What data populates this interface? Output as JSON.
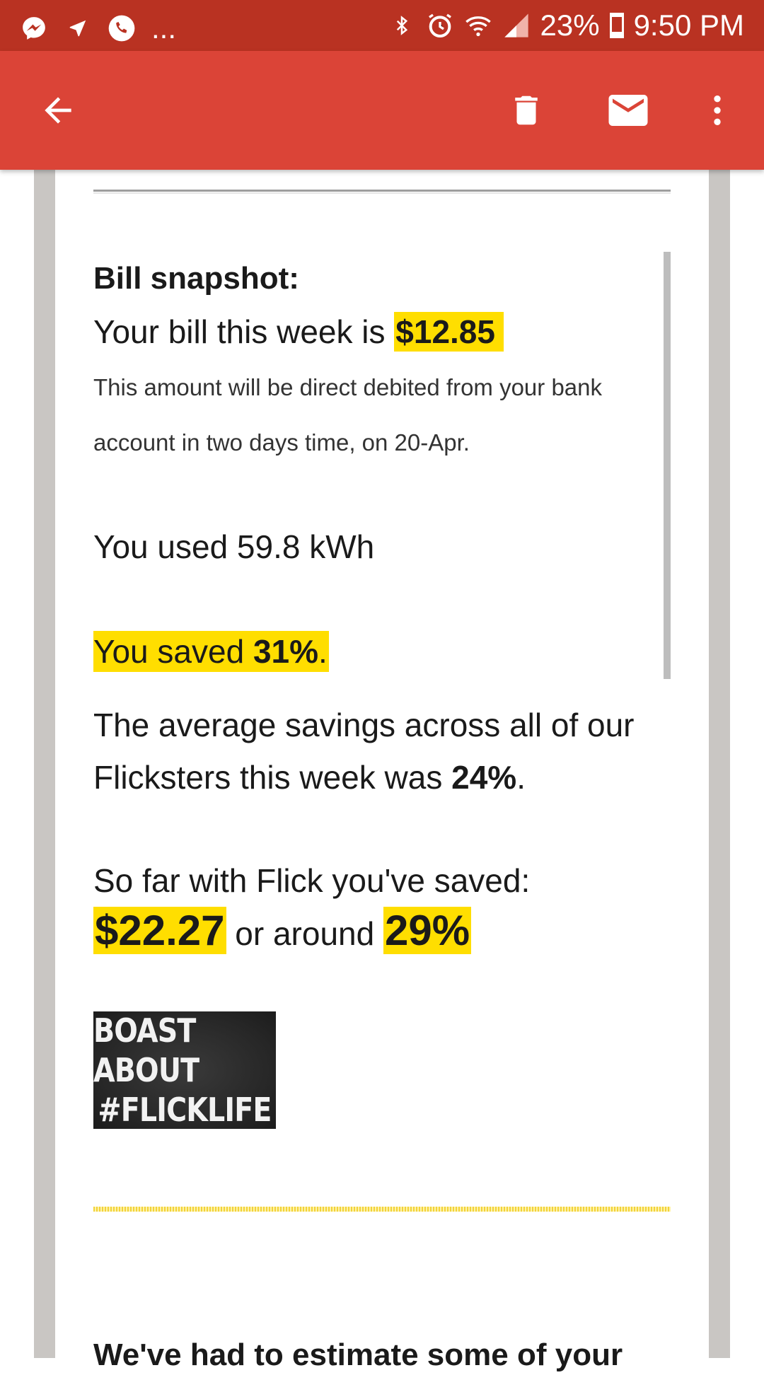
{
  "status_bar": {
    "notifications_more": "...",
    "battery_percent": "23%",
    "time": "9:50 PM"
  },
  "app_bar": {
    "icons": [
      "back-arrow-icon",
      "trash-icon",
      "mail-icon",
      "more-vert-icon"
    ]
  },
  "email": {
    "snapshot_heading": "Bill snapshot:",
    "bill_prefix": "Your bill this week is ",
    "bill_amount": "$12.85",
    "debit_line1": "This amount will be direct debited from your bank",
    "debit_line2": "account in two days time, on 20-Apr.",
    "usage": "You used 59.8 kWh",
    "saved_prefix": "You saved ",
    "saved_percent": "31%",
    "saved_suffix": ".",
    "avg_line1": "The average savings across all of our",
    "avg_line2_prefix": "Flicksters this week was ",
    "avg_percent": "24%",
    "avg_suffix": ".",
    "sofar_label": "So far with Flick you've saved:",
    "sofar_amount": "$22.27",
    "sofar_middle": " or around ",
    "sofar_percent": "29%",
    "boast_line1": "BOAST ABOUT",
    "boast_line2": "#FLICKLIFE",
    "estimate_heading_partial": "We've had to estimate some of your"
  },
  "colors": {
    "status_bar": "#b93222",
    "app_bar": "#db4437",
    "highlight": "#ffde00",
    "frame": "#c9c6c3"
  }
}
